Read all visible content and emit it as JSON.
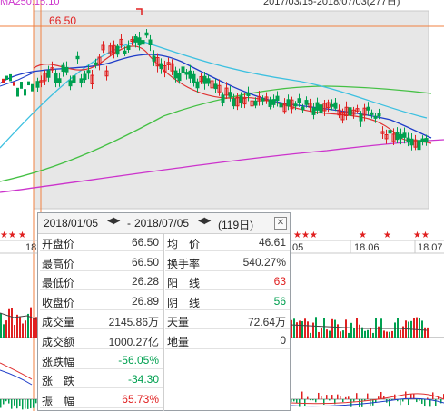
{
  "chart": {
    "top_left_label": "MA250:15.10",
    "top_right_label": "2017/03/15-2018/07/03(277日)",
    "price_marker": "66.50",
    "date_labels": [
      "18",
      "05",
      "18.06",
      "18.07"
    ],
    "colors": {
      "bg": "#e7e7e7",
      "ma5": "#e03030",
      "ma10": "#1e3cc8",
      "ma20": "#3cc0e0",
      "ma60": "#44c044",
      "ma250": "#cc33cc",
      "candle_up": "#e02020",
      "candle_down": "#00a050",
      "selection_line": "#f08040"
    }
  },
  "stats": {
    "date_start": "2018/01/05",
    "date_end": "2018/07/05",
    "date_separator": "-",
    "days": "(119日)",
    "close_icon": "close-icon",
    "left": [
      {
        "label": "开盘价",
        "value": "66.50",
        "color": "#333333"
      },
      {
        "label": "最高价",
        "value": "66.50",
        "color": "#333333"
      },
      {
        "label": "最低价",
        "value": "26.28",
        "color": "#333333"
      },
      {
        "label": "收盘价",
        "value": "26.89",
        "color": "#333333"
      },
      {
        "label": "成交量",
        "value": "2145.86万",
        "color": "#333333"
      },
      {
        "label": "成交额",
        "value": "1000.27亿",
        "color": "#333333"
      },
      {
        "label": "涨跌幅",
        "value": "-56.05%",
        "color": "#00a050"
      },
      {
        "label": "涨　跌",
        "value": "-34.30",
        "color": "#00a050"
      },
      {
        "label": "振　幅",
        "value": "65.73%",
        "color": "#e02020"
      }
    ],
    "right": [
      {
        "label": "均　价",
        "value": "46.61",
        "color": "#333333"
      },
      {
        "label": "换手率",
        "value": "540.27%",
        "color": "#333333"
      },
      {
        "label": "阳　线",
        "value": "63",
        "color": "#e02020"
      },
      {
        "label": "阴　线",
        "value": "56",
        "color": "#00a050"
      },
      {
        "label": "天量",
        "value": "72.64万",
        "color": "#333333"
      },
      {
        "label": "地量",
        "value": "0",
        "color": "#333333"
      }
    ]
  }
}
